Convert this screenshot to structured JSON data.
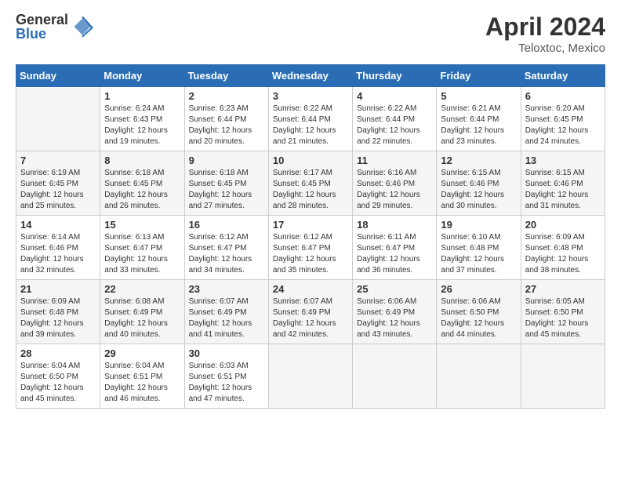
{
  "logo": {
    "general": "General",
    "blue": "Blue"
  },
  "title": "April 2024",
  "location": "Teloxtoc, Mexico",
  "headers": [
    "Sunday",
    "Monday",
    "Tuesday",
    "Wednesday",
    "Thursday",
    "Friday",
    "Saturday"
  ],
  "weeks": [
    [
      {
        "day": "",
        "sunrise": "",
        "sunset": "",
        "daylight": ""
      },
      {
        "day": "1",
        "sunrise": "Sunrise: 6:24 AM",
        "sunset": "Sunset: 6:43 PM",
        "daylight": "Daylight: 12 hours and 19 minutes."
      },
      {
        "day": "2",
        "sunrise": "Sunrise: 6:23 AM",
        "sunset": "Sunset: 6:44 PM",
        "daylight": "Daylight: 12 hours and 20 minutes."
      },
      {
        "day": "3",
        "sunrise": "Sunrise: 6:22 AM",
        "sunset": "Sunset: 6:44 PM",
        "daylight": "Daylight: 12 hours and 21 minutes."
      },
      {
        "day": "4",
        "sunrise": "Sunrise: 6:22 AM",
        "sunset": "Sunset: 6:44 PM",
        "daylight": "Daylight: 12 hours and 22 minutes."
      },
      {
        "day": "5",
        "sunrise": "Sunrise: 6:21 AM",
        "sunset": "Sunset: 6:44 PM",
        "daylight": "Daylight: 12 hours and 23 minutes."
      },
      {
        "day": "6",
        "sunrise": "Sunrise: 6:20 AM",
        "sunset": "Sunset: 6:45 PM",
        "daylight": "Daylight: 12 hours and 24 minutes."
      }
    ],
    [
      {
        "day": "7",
        "sunrise": "Sunrise: 6:19 AM",
        "sunset": "Sunset: 6:45 PM",
        "daylight": "Daylight: 12 hours and 25 minutes."
      },
      {
        "day": "8",
        "sunrise": "Sunrise: 6:18 AM",
        "sunset": "Sunset: 6:45 PM",
        "daylight": "Daylight: 12 hours and 26 minutes."
      },
      {
        "day": "9",
        "sunrise": "Sunrise: 6:18 AM",
        "sunset": "Sunset: 6:45 PM",
        "daylight": "Daylight: 12 hours and 27 minutes."
      },
      {
        "day": "10",
        "sunrise": "Sunrise: 6:17 AM",
        "sunset": "Sunset: 6:45 PM",
        "daylight": "Daylight: 12 hours and 28 minutes."
      },
      {
        "day": "11",
        "sunrise": "Sunrise: 6:16 AM",
        "sunset": "Sunset: 6:46 PM",
        "daylight": "Daylight: 12 hours and 29 minutes."
      },
      {
        "day": "12",
        "sunrise": "Sunrise: 6:15 AM",
        "sunset": "Sunset: 6:46 PM",
        "daylight": "Daylight: 12 hours and 30 minutes."
      },
      {
        "day": "13",
        "sunrise": "Sunrise: 6:15 AM",
        "sunset": "Sunset: 6:46 PM",
        "daylight": "Daylight: 12 hours and 31 minutes."
      }
    ],
    [
      {
        "day": "14",
        "sunrise": "Sunrise: 6:14 AM",
        "sunset": "Sunset: 6:46 PM",
        "daylight": "Daylight: 12 hours and 32 minutes."
      },
      {
        "day": "15",
        "sunrise": "Sunrise: 6:13 AM",
        "sunset": "Sunset: 6:47 PM",
        "daylight": "Daylight: 12 hours and 33 minutes."
      },
      {
        "day": "16",
        "sunrise": "Sunrise: 6:12 AM",
        "sunset": "Sunset: 6:47 PM",
        "daylight": "Daylight: 12 hours and 34 minutes."
      },
      {
        "day": "17",
        "sunrise": "Sunrise: 6:12 AM",
        "sunset": "Sunset: 6:47 PM",
        "daylight": "Daylight: 12 hours and 35 minutes."
      },
      {
        "day": "18",
        "sunrise": "Sunrise: 6:11 AM",
        "sunset": "Sunset: 6:47 PM",
        "daylight": "Daylight: 12 hours and 36 minutes."
      },
      {
        "day": "19",
        "sunrise": "Sunrise: 6:10 AM",
        "sunset": "Sunset: 6:48 PM",
        "daylight": "Daylight: 12 hours and 37 minutes."
      },
      {
        "day": "20",
        "sunrise": "Sunrise: 6:09 AM",
        "sunset": "Sunset: 6:48 PM",
        "daylight": "Daylight: 12 hours and 38 minutes."
      }
    ],
    [
      {
        "day": "21",
        "sunrise": "Sunrise: 6:09 AM",
        "sunset": "Sunset: 6:48 PM",
        "daylight": "Daylight: 12 hours and 39 minutes."
      },
      {
        "day": "22",
        "sunrise": "Sunrise: 6:08 AM",
        "sunset": "Sunset: 6:49 PM",
        "daylight": "Daylight: 12 hours and 40 minutes."
      },
      {
        "day": "23",
        "sunrise": "Sunrise: 6:07 AM",
        "sunset": "Sunset: 6:49 PM",
        "daylight": "Daylight: 12 hours and 41 minutes."
      },
      {
        "day": "24",
        "sunrise": "Sunrise: 6:07 AM",
        "sunset": "Sunset: 6:49 PM",
        "daylight": "Daylight: 12 hours and 42 minutes."
      },
      {
        "day": "25",
        "sunrise": "Sunrise: 6:06 AM",
        "sunset": "Sunset: 6:49 PM",
        "daylight": "Daylight: 12 hours and 43 minutes."
      },
      {
        "day": "26",
        "sunrise": "Sunrise: 6:06 AM",
        "sunset": "Sunset: 6:50 PM",
        "daylight": "Daylight: 12 hours and 44 minutes."
      },
      {
        "day": "27",
        "sunrise": "Sunrise: 6:05 AM",
        "sunset": "Sunset: 6:50 PM",
        "daylight": "Daylight: 12 hours and 45 minutes."
      }
    ],
    [
      {
        "day": "28",
        "sunrise": "Sunrise: 6:04 AM",
        "sunset": "Sunset: 6:50 PM",
        "daylight": "Daylight: 12 hours and 45 minutes."
      },
      {
        "day": "29",
        "sunrise": "Sunrise: 6:04 AM",
        "sunset": "Sunset: 6:51 PM",
        "daylight": "Daylight: 12 hours and 46 minutes."
      },
      {
        "day": "30",
        "sunrise": "Sunrise: 6:03 AM",
        "sunset": "Sunset: 6:51 PM",
        "daylight": "Daylight: 12 hours and 47 minutes."
      },
      {
        "day": "",
        "sunrise": "",
        "sunset": "",
        "daylight": ""
      },
      {
        "day": "",
        "sunrise": "",
        "sunset": "",
        "daylight": ""
      },
      {
        "day": "",
        "sunrise": "",
        "sunset": "",
        "daylight": ""
      },
      {
        "day": "",
        "sunrise": "",
        "sunset": "",
        "daylight": ""
      }
    ]
  ]
}
